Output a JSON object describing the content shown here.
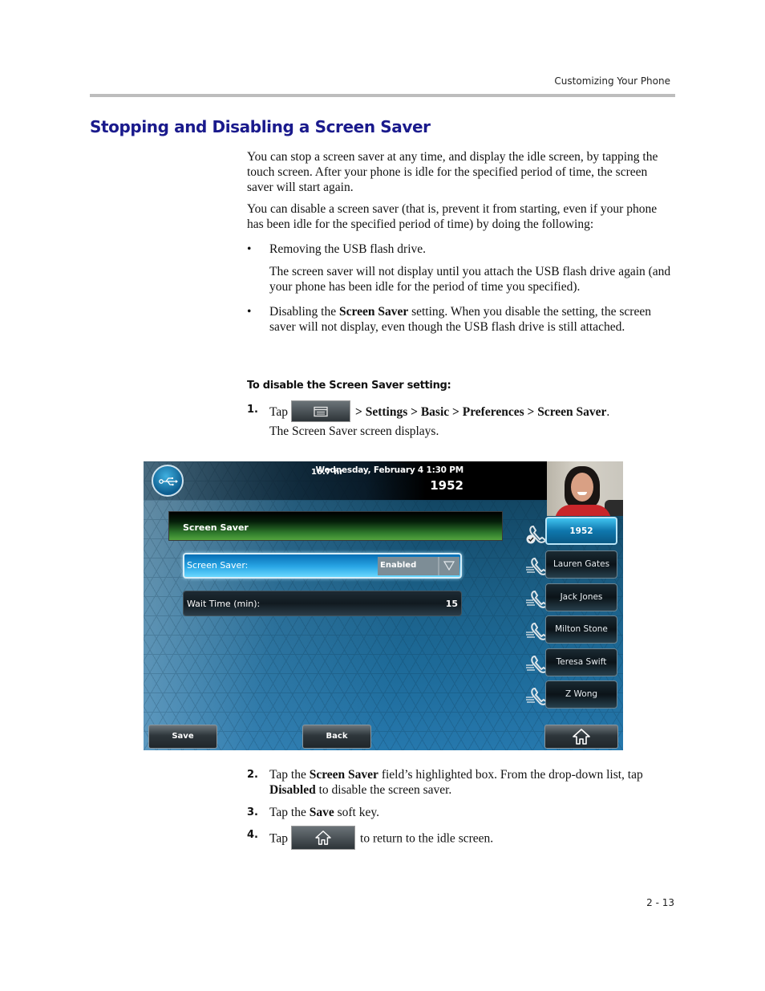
{
  "header": {
    "running_head": "Customizing Your Phone"
  },
  "section": {
    "title": "Stopping and Disabling a Screen Saver",
    "para1": "You can stop a screen saver at any time, and display the idle screen, by tapping the touch screen. After your phone is idle for the specified period of time, the screen saver will start again.",
    "para2": "You can disable a screen saver (that is, prevent it from starting, even if your phone has been idle for the specified period of time) by doing the following:",
    "bullets": [
      {
        "marker": "•",
        "text": "Removing the USB flash drive.",
        "sub": "The screen saver will not display until you attach the USB flash drive again (and your phone has been idle for the period of time you specified)."
      },
      {
        "marker": "•",
        "text_pre": "Disabling the ",
        "text_bold": "Screen Saver",
        "text_post": " setting. When you disable the setting, the screen saver will not display, even though the USB flash drive is still attached."
      }
    ]
  },
  "procedure": {
    "heading": "To disable the Screen Saver setting:",
    "steps": [
      {
        "num": "1.",
        "pre": "Tap",
        "icon": "menu-key-icon",
        "path": "> Settings > Basic > Preferences > Screen Saver",
        "post": ".",
        "sub": "The Screen Saver screen displays."
      },
      {
        "num": "2.",
        "pre": "Tap the ",
        "bold1": "Screen Saver",
        "mid": " field’s highlighted box. From the drop-down list, tap ",
        "bold2": "Disabled",
        "post": " to disable the screen saver."
      },
      {
        "num": "3.",
        "pre": "Tap the ",
        "bold": "Save",
        "post": " soft key."
      },
      {
        "num": "4.",
        "pre": "Tap",
        "icon": "home-key-icon",
        "post": "to return to the idle screen."
      }
    ]
  },
  "phone_screen": {
    "usb_icon": "usb-icon",
    "hours": "16.7 hr",
    "datetime": "Wednesday, February 4  1:30 PM",
    "extension": "1952",
    "screen_title": "Screen Saver",
    "fields": [
      {
        "label": "Screen Saver:",
        "value": "Enabled",
        "type": "dropdown"
      },
      {
        "label": "Wait Time (min):",
        "value": "15",
        "type": "number"
      }
    ],
    "line_keys": [
      {
        "label": "1952",
        "active": true,
        "icon": "handset-registered-icon"
      },
      {
        "label": "Lauren Gates",
        "active": false,
        "icon": "handset-speed-dial-icon"
      },
      {
        "label": "Jack Jones",
        "active": false,
        "icon": "handset-speed-dial-icon"
      },
      {
        "label": "Milton Stone",
        "active": false,
        "icon": "handset-speed-dial-icon"
      },
      {
        "label": "Teresa Swift",
        "active": false,
        "icon": "handset-speed-dial-icon"
      },
      {
        "label": "Z Wong",
        "active": false,
        "icon": "handset-speed-dial-icon"
      }
    ],
    "softkeys": {
      "save": "Save",
      "back": "Back",
      "home_icon": "home-icon"
    }
  },
  "footer": {
    "page_number": "2 - 13"
  }
}
